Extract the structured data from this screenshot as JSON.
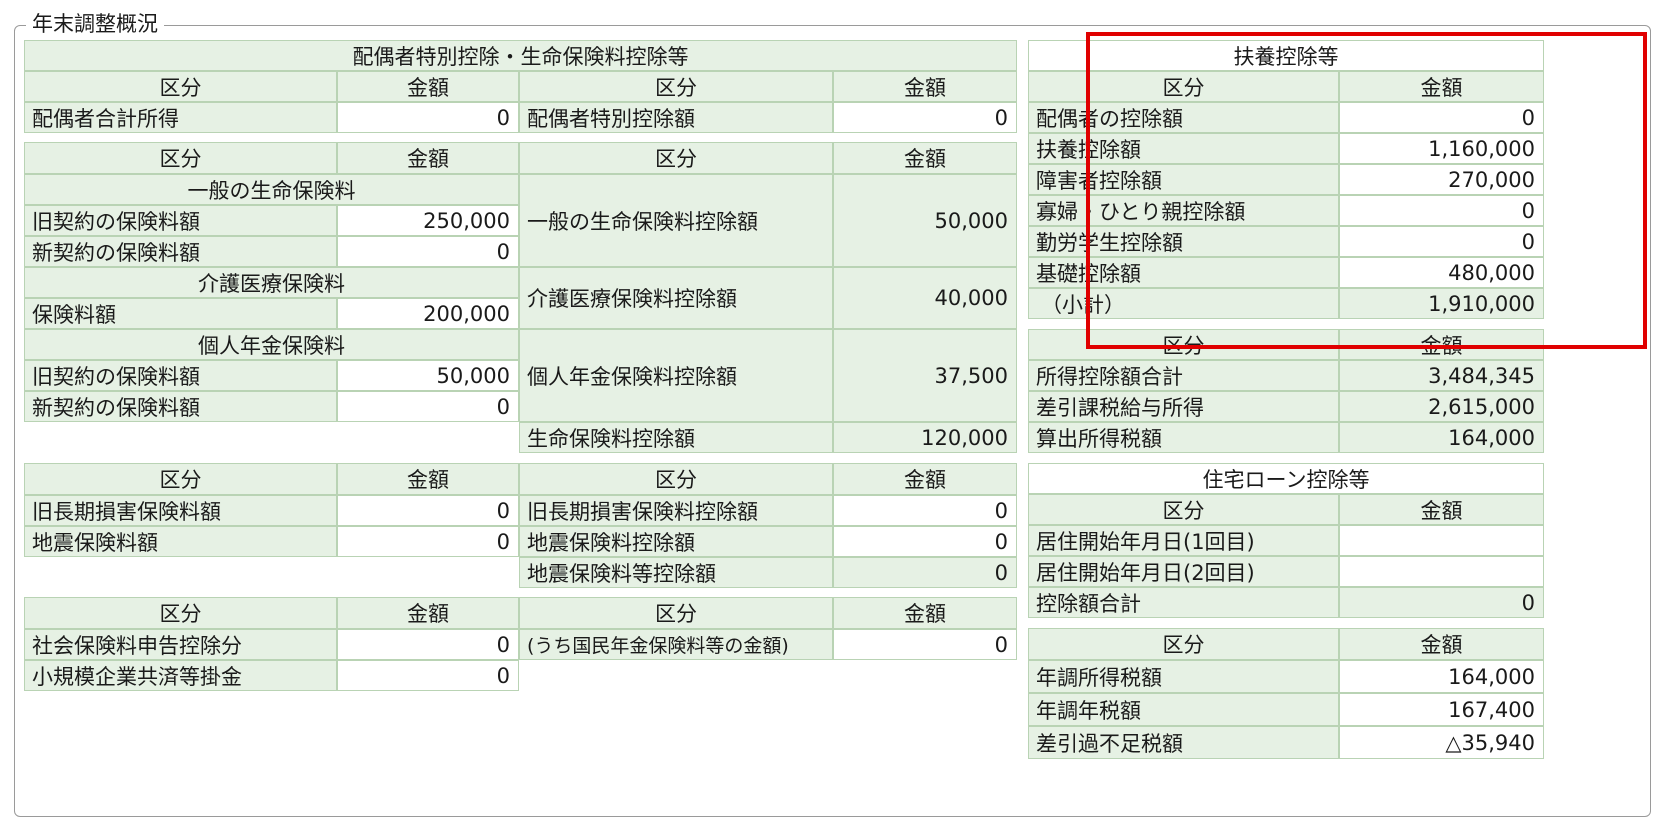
{
  "group_title": "年末調整概況",
  "headers": {
    "kubun": "区分",
    "kingaku": "金額"
  },
  "spouse": {
    "title": "配偶者特別控除・生命保険料控除等",
    "income_label": "配偶者合計所得",
    "income_value": "0",
    "special_label": "配偶者特別控除額",
    "special_value": "0"
  },
  "life": {
    "general_title": "一般の生命保険料",
    "general_old_label": "旧契約の保険料額",
    "general_old_value": "250,000",
    "general_new_label": "新契約の保険料額",
    "general_new_value": "0",
    "care_title": "介護医療保険料",
    "care_label": "保険料額",
    "care_value": "200,000",
    "pension_title": "個人年金保険料",
    "pension_old_label": "旧契約の保険料額",
    "pension_old_value": "50,000",
    "pension_new_label": "新契約の保険料額",
    "pension_new_value": "0",
    "general_ded_label": "一般の生命保険料控除額",
    "general_ded_value": "50,000",
    "care_ded_label": "介護医療保険料控除額",
    "care_ded_value": "40,000",
    "pension_ded_label": "個人年金保険料控除額",
    "pension_ded_value": "37,500",
    "total_label": "生命保険料控除額",
    "total_value": "120,000"
  },
  "quake": {
    "old_long_label": "旧長期損害保険料額",
    "old_long_value": "0",
    "quake_label": "地震保険料額",
    "quake_value": "0",
    "old_long_ded_label": "旧長期損害保険料控除額",
    "old_long_ded_value": "0",
    "quake_ded_label": "地震保険料控除額",
    "quake_ded_value": "0",
    "quake_total_label": "地震保険料等控除額",
    "quake_total_value": "0"
  },
  "social": {
    "social_label": "社会保険料申告控除分",
    "social_value": "0",
    "small_label": "小規模企業共済等掛金",
    "small_value": "0",
    "national_label": "(うち国民年金保険料等の金額)",
    "national_value": "0"
  },
  "dependents": {
    "title": "扶養控除等",
    "rows": [
      {
        "label": "配偶者の控除額",
        "value": "0"
      },
      {
        "label": "扶養控除額",
        "value": "1,160,000"
      },
      {
        "label": "障害者控除額",
        "value": "270,000"
      },
      {
        "label": "寡婦・ひとり親控除額",
        "value": "0"
      },
      {
        "label": "勤労学生控除額",
        "value": "0"
      },
      {
        "label": "基礎控除額",
        "value": "480,000"
      },
      {
        "label": "（小計）",
        "value": "1,910,000"
      }
    ]
  },
  "income": {
    "rows": [
      {
        "label": "所得控除額合計",
        "value": "3,484,345"
      },
      {
        "label": "差引課税給与所得",
        "value": "2,615,000"
      },
      {
        "label": "算出所得税額",
        "value": "164,000"
      }
    ]
  },
  "housing": {
    "title": "住宅ローン控除等",
    "rows": [
      {
        "label": "居住開始年月日(1回目)",
        "value": ""
      },
      {
        "label": "居住開始年月日(2回目)",
        "value": ""
      },
      {
        "label": "控除額合計",
        "value": "0"
      }
    ]
  },
  "final": {
    "rows": [
      {
        "label": "年調所得税額",
        "value": "164,000"
      },
      {
        "label": "年調年税額",
        "value": "167,400"
      },
      {
        "label": "差引過不足税額",
        "value": "△35,940"
      }
    ]
  },
  "colors": {
    "header_bg": "#e6f1e4",
    "border": "#b9d3b4",
    "highlight": "#e00000"
  }
}
